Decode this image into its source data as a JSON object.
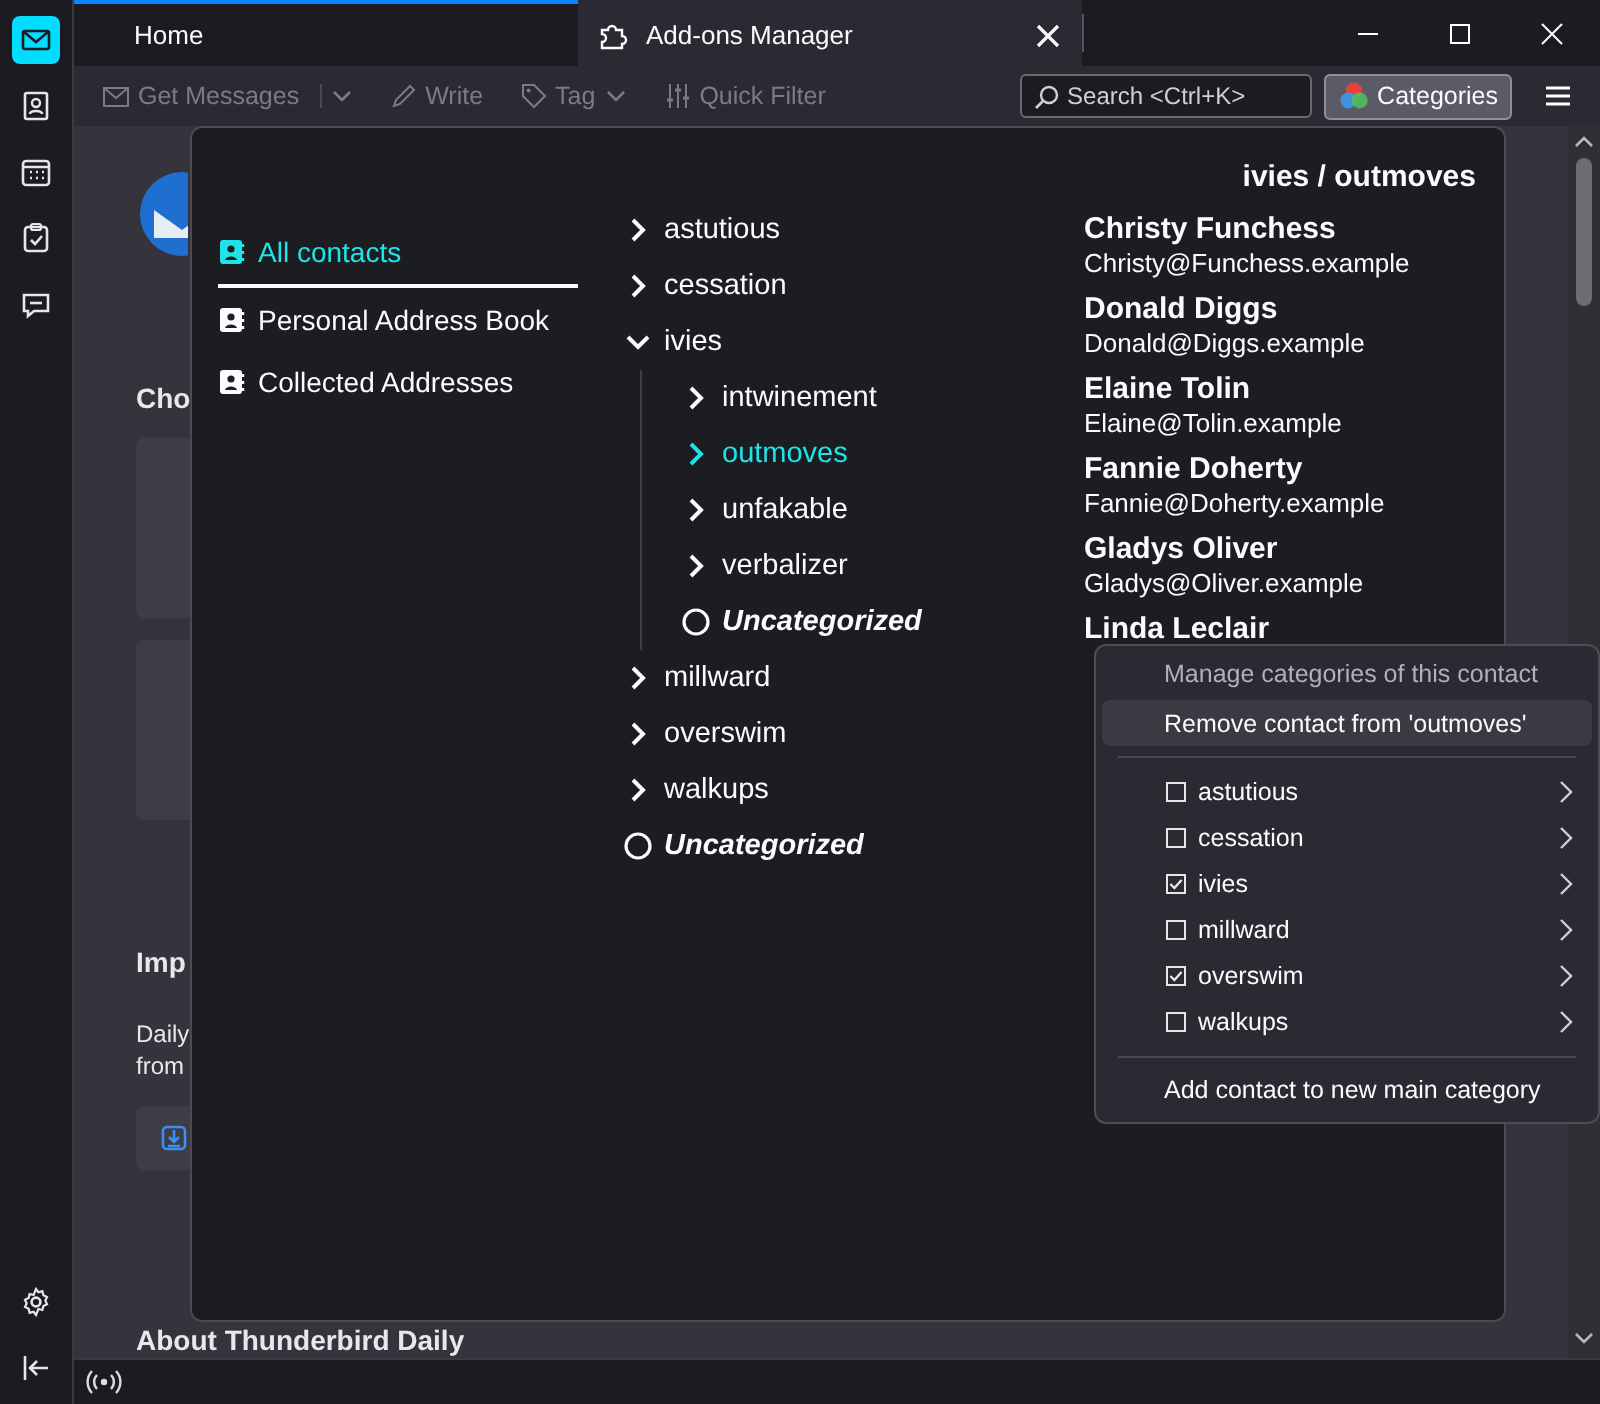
{
  "spaces": [
    {
      "kind": "mail",
      "selected": true
    },
    {
      "kind": "contacts",
      "selected": false
    },
    {
      "kind": "calendar",
      "selected": false
    },
    {
      "kind": "tasks",
      "selected": false
    },
    {
      "kind": "chat",
      "selected": false
    }
  ],
  "tabs": [
    {
      "label": "Home",
      "selected": true,
      "kind": "home"
    },
    {
      "label": "Add-ons Manager",
      "selected": false,
      "kind": "addons"
    }
  ],
  "toolbar": {
    "buttons": [
      {
        "label": "Get Messages",
        "kind": "get",
        "disabled": true
      },
      {
        "label": "Write",
        "kind": "write",
        "disabled": true
      },
      {
        "label": "Tag",
        "kind": "tag",
        "disabled": true
      },
      {
        "label": "Quick Filter",
        "kind": "filter",
        "disabled": true
      }
    ],
    "search": {
      "placeholder": "Search <Ctrl+K>"
    },
    "categories_button": "Categories"
  },
  "background": {
    "heading_1": "Cho",
    "heading_2": "Imp",
    "lines": [
      "Daily",
      "from"
    ],
    "heading_3": "About Thunderbird Daily"
  },
  "popup": {
    "title": "ivies / outmoves",
    "address_books": [
      {
        "label": "All contacts",
        "selected": true
      },
      {
        "label": "Personal Address Book",
        "selected": false
      },
      {
        "label": "Collected Addresses",
        "selected": false
      }
    ],
    "categories": [
      {
        "label": "astutious",
        "kind": "category",
        "selected": false
      },
      {
        "label": "cessation",
        "kind": "category",
        "selected": false
      },
      {
        "label": "ivies",
        "kind": "category",
        "expanded": true,
        "selected": false,
        "children": [
          {
            "label": "intwinement",
            "kind": "category",
            "selected": false
          },
          {
            "label": "outmoves",
            "kind": "category",
            "selected": true
          },
          {
            "label": "unfakable",
            "kind": "category",
            "selected": false
          },
          {
            "label": "verbalizer",
            "kind": "category",
            "selected": false
          },
          {
            "label": "Uncategorized",
            "kind": "uncategorized",
            "selected": false
          }
        ]
      },
      {
        "label": "millward",
        "kind": "category",
        "selected": false
      },
      {
        "label": "overswim",
        "kind": "category",
        "selected": false
      },
      {
        "label": "walkups",
        "kind": "category",
        "selected": false
      },
      {
        "label": "Uncategorized",
        "kind": "uncategorized",
        "selected": false
      }
    ],
    "contacts": [
      {
        "name": "Christy Funchess",
        "email": "Christy@Funchess.example"
      },
      {
        "name": "Donald Diggs",
        "email": "Donald@Diggs.example"
      },
      {
        "name": "Elaine Tolin",
        "email": "Elaine@Tolin.example"
      },
      {
        "name": "Fannie Doherty",
        "email": "Fannie@Doherty.example"
      },
      {
        "name": "Gladys Oliver",
        "email": "Gladys@Oliver.example"
      },
      {
        "name": "Linda Leclair"
      }
    ]
  },
  "context_menu": {
    "heading": "Manage categories of this contact",
    "items": [
      {
        "kind": "action",
        "label": "Remove contact from 'outmoves'",
        "selected": true
      },
      {
        "kind": "separator"
      },
      {
        "kind": "check",
        "label": "astutious",
        "checked": false
      },
      {
        "kind": "check",
        "label": "cessation",
        "checked": false
      },
      {
        "kind": "check",
        "label": "ivies",
        "checked": true
      },
      {
        "kind": "check",
        "label": "millward",
        "checked": false
      },
      {
        "kind": "check",
        "label": "overswim",
        "checked": true
      },
      {
        "kind": "check",
        "label": "walkups",
        "checked": false
      },
      {
        "kind": "separator"
      },
      {
        "kind": "action",
        "label": "Add contact to new main category",
        "selected": false
      }
    ]
  }
}
